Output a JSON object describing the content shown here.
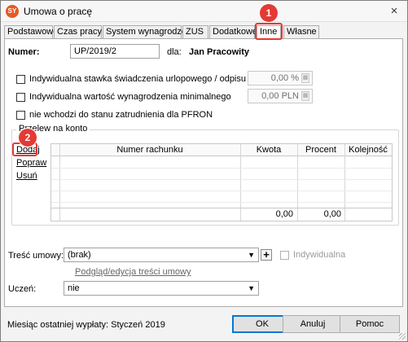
{
  "window": {
    "title": "Umowa o pracę",
    "icon": "app-logo-icon",
    "close": "×"
  },
  "tabs": [
    "Podstawowe",
    "Czas pracy",
    "System wynagrodzeń",
    "ZUS",
    "Dodatkowe",
    "Inne",
    "Własne"
  ],
  "active_tab": "Inne",
  "badges": {
    "tab_step": "1",
    "add_step": "2"
  },
  "form": {
    "numer_label": "Numer:",
    "numer_value": "UP/2019/2",
    "dla_label": "dla:",
    "employee_name": "Jan Pracowity",
    "cb1_label": "Indywidualna stawka świadczenia urlopowego / odpisu na ZFŚS",
    "cb1_value": "0,00 %",
    "cb2_label": "Indywidualna wartość wynagrodzenia minimalnego",
    "cb2_value": "0,00 PLN",
    "cb3_label": "nie wchodzi do stanu zatrudnienia dla PFRON"
  },
  "transfer": {
    "group_title": "Przelew na konto",
    "actions": {
      "add": "Dodaj",
      "edit": "Popraw",
      "delete": "Usuń"
    },
    "columns": [
      "Numer rachunku",
      "Kwota",
      "Procent",
      "Kolejność"
    ],
    "totals": {
      "kwota": "0,00",
      "procent": "0,00"
    }
  },
  "contract": {
    "tresc_label": "Treść umowy:",
    "tresc_value": "(brak)",
    "individual_label": "Indywidualna",
    "preview_link": "Podgląd/edycja treści umowy",
    "uczen_label": "Uczeń:",
    "uczen_value": "nie"
  },
  "footer": {
    "last_payment": "Miesiąc ostatniej wypłaty: Styczeń 2019",
    "ok": "OK",
    "cancel": "Anuluj",
    "help": "Pomoc"
  },
  "colors": {
    "accent_highlight": "#e53935",
    "default_button": "#0078d7"
  }
}
